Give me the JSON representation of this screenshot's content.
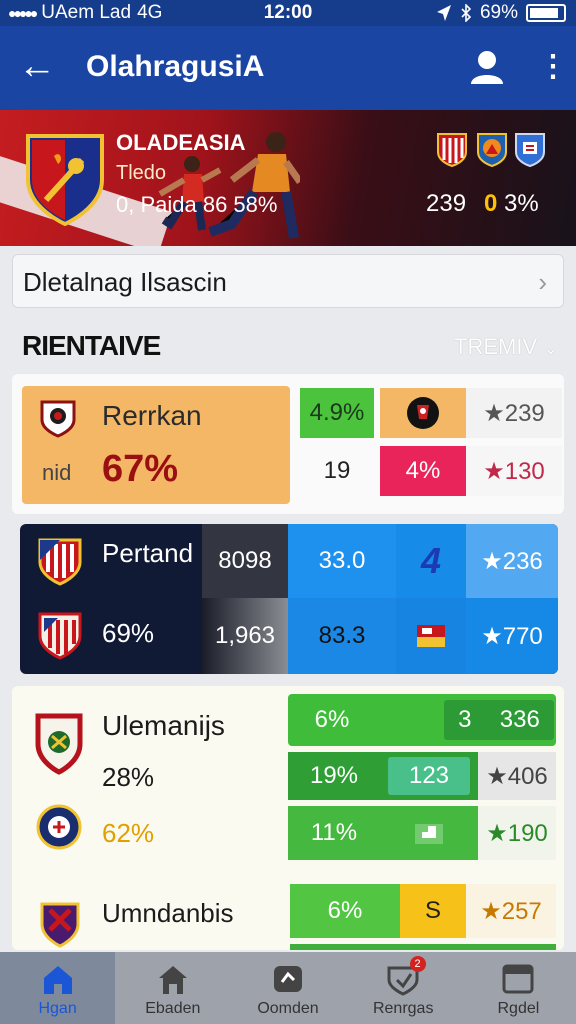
{
  "status_bar": {
    "carrier": "UAem Lad",
    "network": "4G",
    "time": "12:00",
    "battery": "69%"
  },
  "app_bar": {
    "title": "OlahragusiA"
  },
  "banner": {
    "title": "OLADEASIA",
    "subtitle": "Tledo",
    "line": "0, Paida 86 58%",
    "score_left": "239",
    "score_right_gold": "0",
    "score_right_rest": "3%"
  },
  "search": {
    "text": "Dletalnag Ilsascin"
  },
  "section": {
    "title": "RIENTAIVE",
    "action": "TREMIV"
  },
  "card1": {
    "team_name": "Rerrkan",
    "prefix": "nid",
    "percent": "67%",
    "c1": "4.9%",
    "c2": "19",
    "c3": "4%",
    "c4": "★239",
    "c5": "★130"
  },
  "card2": {
    "team_name": "Pertand",
    "percent": "69%",
    "r1c1": "8098",
    "r1c2": "33.0",
    "r1c3": "4",
    "r1c4": "★236",
    "r2c1": "1,963",
    "r2c2": "83.3",
    "r2c4": "★770"
  },
  "card3": {
    "team_name": "Ulemanijs",
    "percent1": "28%",
    "percent2": "62%",
    "r1c1": "6%",
    "r1c2": "3",
    "r1c3": "336",
    "r2c1": "19%",
    "r2c2": "123",
    "r2c3": "★406",
    "r3c1": "11%",
    "r3c3": "★190",
    "team2_name": "Umndanbis",
    "r4c1": "6%",
    "r4c2": "S",
    "r4c3": "★257"
  },
  "bottom_nav": {
    "items": [
      {
        "label": "Hgan"
      },
      {
        "label": "Ebaden"
      },
      {
        "label": "Oomden"
      },
      {
        "label": "Renrgas",
        "badge": "2"
      },
      {
        "label": "Rgdel"
      }
    ]
  }
}
